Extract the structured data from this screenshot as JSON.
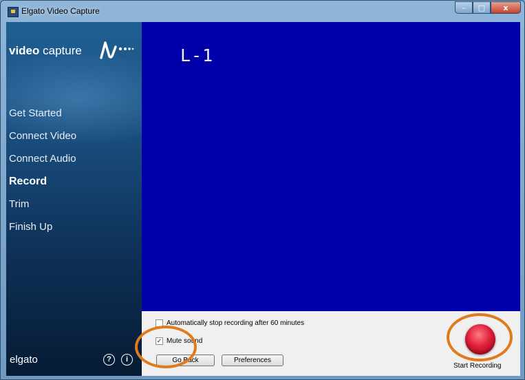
{
  "window": {
    "title": "Elgato Video Capture",
    "controls": {
      "minimize": "–",
      "maximize": "□",
      "close": "x"
    }
  },
  "sidebar": {
    "logo": {
      "bold": "video",
      "regular": "capture"
    },
    "nav": [
      {
        "label": "Get Started",
        "active": false
      },
      {
        "label": "Connect Video",
        "active": false
      },
      {
        "label": "Connect Audio",
        "active": false
      },
      {
        "label": "Record",
        "active": true
      },
      {
        "label": "Trim",
        "active": false
      },
      {
        "label": "Finish Up",
        "active": false
      }
    ],
    "brand": "elgato",
    "help_icon": "?",
    "info_icon": "i"
  },
  "video": {
    "osd_text": "L-1",
    "background": "#0000aa"
  },
  "options": {
    "auto_stop": {
      "label": "Automatically stop recording after 60 minutes",
      "checked": false
    },
    "mute": {
      "label": "Mute sound",
      "checked": true
    }
  },
  "buttons": {
    "go_back": "Go Back",
    "preferences": "Preferences",
    "start_recording": "Start Recording"
  },
  "colors": {
    "highlight_ring": "#e07a1c",
    "record_button": "#e0203a"
  }
}
